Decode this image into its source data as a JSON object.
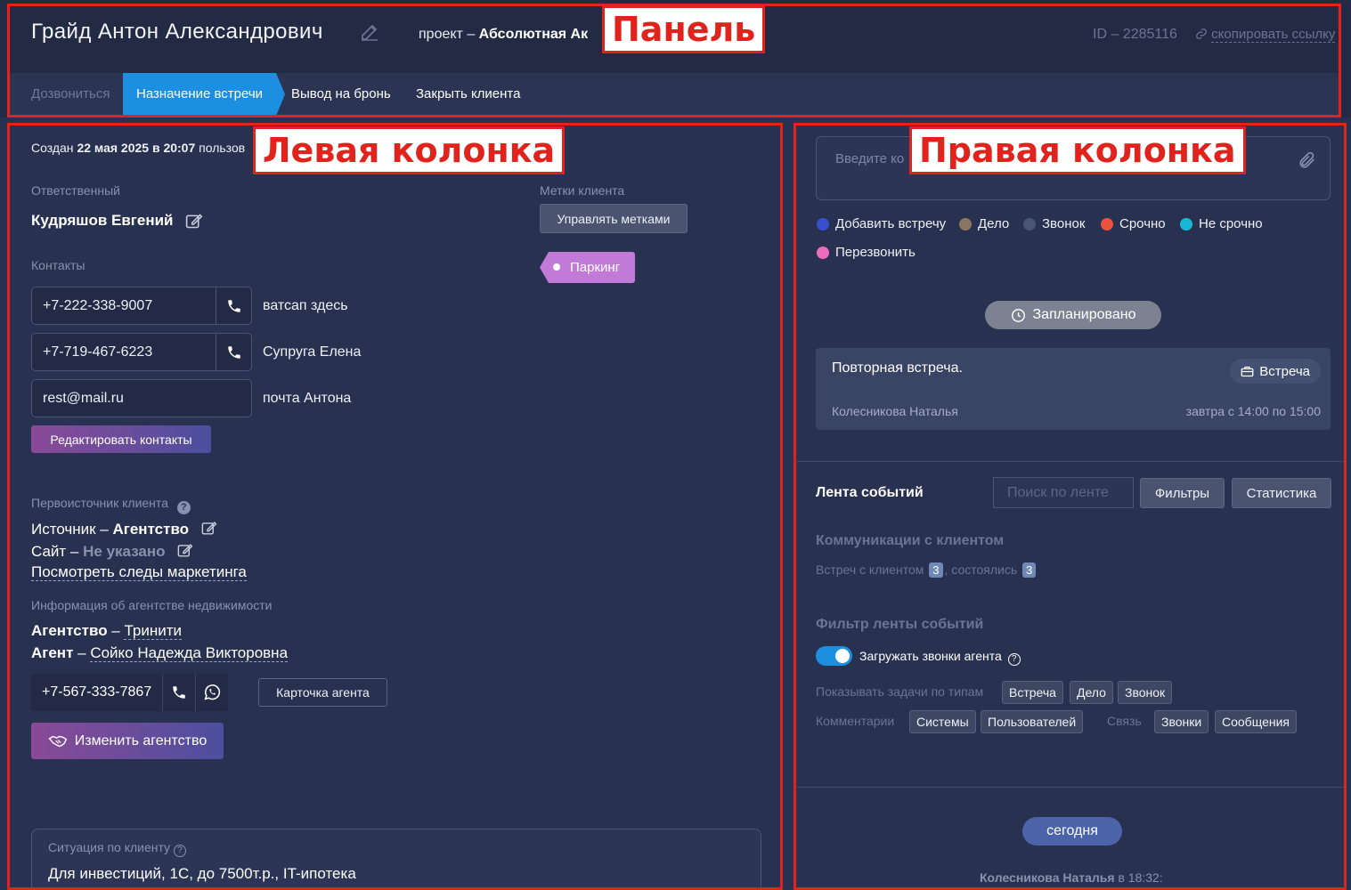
{
  "header": {
    "client_name": "Грайд Антон Александрович",
    "project_prefix": "проект – ",
    "project_name": "Абсолютная Ак",
    "id_text": "ID – 2285116",
    "copy_link": "скопировать ссылку"
  },
  "steps": {
    "call": "Дозвониться",
    "meeting": "Назначение встречи",
    "booking": "Вывод на бронь",
    "close": "Закрыть клиента"
  },
  "callouts": {
    "panel": "Панель",
    "left": "Левая колонка",
    "right": "Правая колонка"
  },
  "left": {
    "created_prefix": "Создан ",
    "created_date": "22 мая 2025 в 20:07",
    "created_suffix": " пользов",
    "responsible_label": "Ответственный",
    "responsible_name": "Кудряшов Евгений",
    "tags_label": "Метки клиента",
    "manage_tags": "Управлять метками",
    "tag_parking": "Паркинг",
    "contacts_label": "Контакты",
    "contacts": [
      {
        "value": "+7-222-338-9007",
        "note": "ватсап здесь"
      },
      {
        "value": "+7-719-467-6223",
        "note": "Супруга Елена"
      },
      {
        "value": "rest@mail.ru",
        "note": "почта Антона"
      }
    ],
    "edit_contacts": "Редактировать контакты",
    "source_label": "Первоисточник клиента",
    "source_prefix": "Источник – ",
    "source_value": "Агентство",
    "site_prefix": "Сайт – ",
    "site_value": "Не указано",
    "marketing_link": "Посмотреть следы маркетинга",
    "agency_info_label": "Информация об агентстве недвижимости",
    "agency_key": "Агентство",
    "agency_value": "Тринити",
    "agent_key": "Агент",
    "agent_value": "Сойко Надежда Викторовна",
    "dash": " – ",
    "agent_phone": "+7-567-333-7867",
    "agent_card": "Карточка агента",
    "change_agency": "Изменить агентство",
    "situation_label": "Ситуация по клиенту",
    "situation_text": "Для инвестиций, 1С, до 7500т.р., IT-ипотека"
  },
  "right": {
    "comment_placeholder": "Введите ко",
    "legend": [
      {
        "label": "Добавить встречу",
        "color": "#3a4fd0"
      },
      {
        "label": "Дело",
        "color": "#8a7560"
      },
      {
        "label": "Звонок",
        "color": "#4a5575"
      },
      {
        "label": "Срочно",
        "color": "#e8533f"
      },
      {
        "label": "Не срочно",
        "color": "#1ab8d8"
      },
      {
        "label": "Перезвонить",
        "color": "#ee6cc0"
      }
    ],
    "planned": "Запланировано",
    "task_title": "Повторная встреча.",
    "task_type": "Встреча",
    "task_author": "Колесникова Наталья",
    "task_time": "завтра с 14:00 по 15:00",
    "feed_title": "Лента событий",
    "feed_search_placeholder": "Поиск по ленте",
    "filters": "Фильтры",
    "stats": "Статистика",
    "comm_title": "Коммуникации с клиентом",
    "meetings_text": "Встреч с клиентом",
    "meetings_count": "3",
    "held_text": ", состоялись",
    "held_count": "3",
    "filter_title": "Фильтр ленты событий",
    "load_agent_calls": "Загружать звонки агента",
    "show_tasks_label": "Показывать задачи по типам",
    "task_types": [
      "Встреча",
      "Дело",
      "Звонок"
    ],
    "comments_label": "Комментарии",
    "comment_types": [
      "Системы",
      "Пользователей"
    ],
    "link_label": "Связь",
    "link_types": [
      "Звонки",
      "Сообщения"
    ],
    "today": "сегодня",
    "feed_author": "Колесникова Наталья",
    "feed_author_suffix": " в 18:32:"
  }
}
